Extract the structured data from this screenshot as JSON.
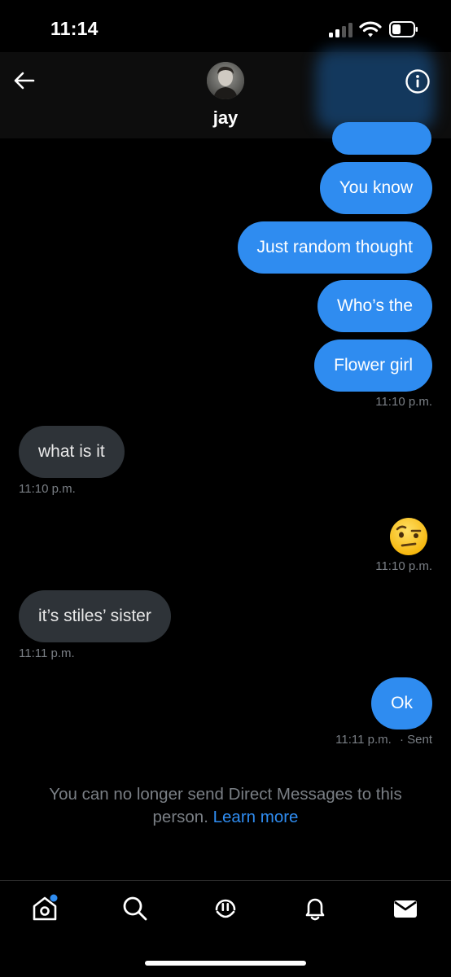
{
  "status_bar": {
    "time": "11:14"
  },
  "header": {
    "contact_name": "jay"
  },
  "messages": [
    {
      "from": "me",
      "text": "You know"
    },
    {
      "from": "me",
      "text": "Just random thought"
    },
    {
      "from": "me",
      "text": "Who’s the"
    },
    {
      "from": "me",
      "text": "Flower girl",
      "timestamp": "11:10 p.m."
    },
    {
      "from": "them",
      "text": "what is it",
      "timestamp": "11:10 p.m."
    },
    {
      "from": "me",
      "emoji": "face-with-raised-eyebrow",
      "timestamp": "11:10 p.m."
    },
    {
      "from": "them",
      "text": "it’s stiles’ sister",
      "timestamp": "11:11 p.m."
    },
    {
      "from": "me",
      "text": "Ok",
      "timestamp": "11:11 p.m.",
      "status": "· Sent"
    }
  ],
  "notice": {
    "text": "You can no longer send Direct Messages to this person.",
    "link": "Learn more"
  },
  "bottom_nav": {
    "items": [
      "home-icon",
      "search-icon",
      "spaces-icon",
      "notifications-icon",
      "messages-icon"
    ],
    "active_dot_color": "#2f8cf0"
  },
  "colors": {
    "accent": "#2f8cf0",
    "incoming_bubble": "#2e3338",
    "secondary_text": "#7a7f85"
  }
}
